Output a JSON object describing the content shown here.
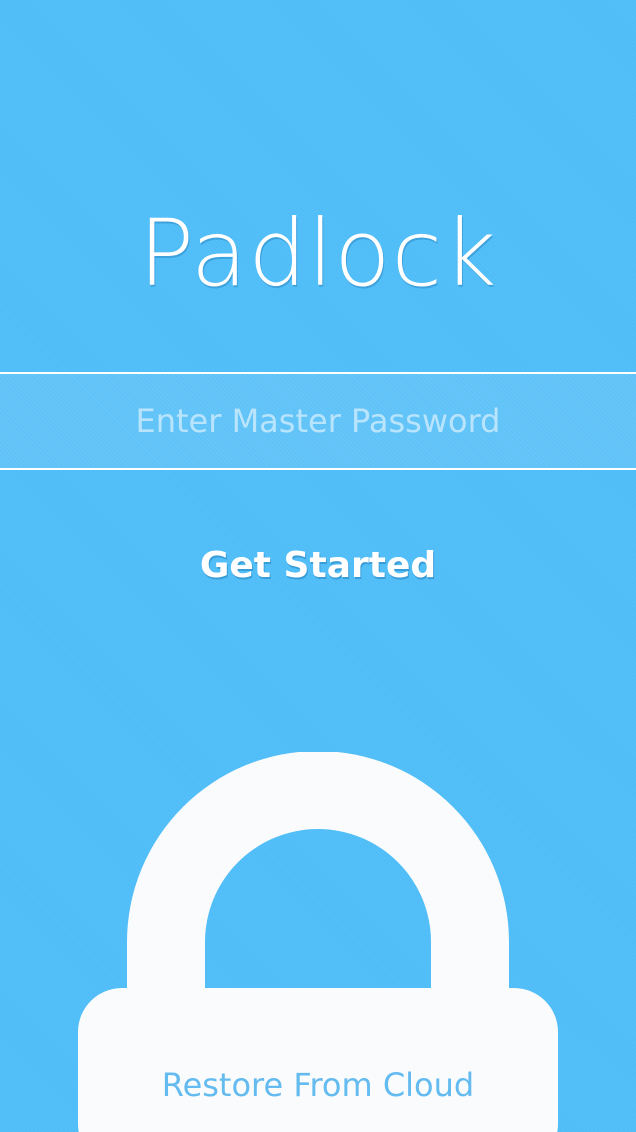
{
  "app": {
    "title": "Padlock"
  },
  "login": {
    "password_placeholder": "Enter Master Password",
    "password_value": "",
    "get_started_label": "Get Started",
    "restore_label": "Restore From Cloud"
  },
  "icons": {
    "padlock": "padlock-icon"
  },
  "colors": {
    "background": "#4fbdf8",
    "foreground": "#ffffff",
    "padlock_body": "#fafbfd",
    "restore_text": "#64bbef"
  }
}
